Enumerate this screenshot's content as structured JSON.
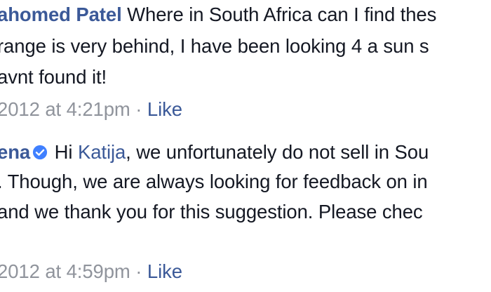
{
  "comments": [
    {
      "author": "ahomed Patel",
      "lines": [
        "Where in South Africa can I find thes",
        "range is very behind, I have been looking 4 a sun s",
        "avnt found it!"
      ],
      "timestamp": "2012 at 4:21pm",
      "separator": "·",
      "like_label": "Like"
    },
    {
      "author": "ena",
      "verified_icon": "verified-badge-icon",
      "line1_pre": "Hi",
      "line1_link": "Katija",
      "line1_post": ", we unfortunately do not sell in Sou",
      "lines": [
        ". Though, we are always looking for feedback on in",
        "and we thank you for this suggestion. Please chec"
      ],
      "timestamp": "2012 at 4:59pm",
      "separator": "·",
      "like_label": "Like"
    }
  ],
  "colors": {
    "link": "#3b5998",
    "text": "#141823",
    "meta": "#90949c",
    "badge": "#4080ff"
  }
}
